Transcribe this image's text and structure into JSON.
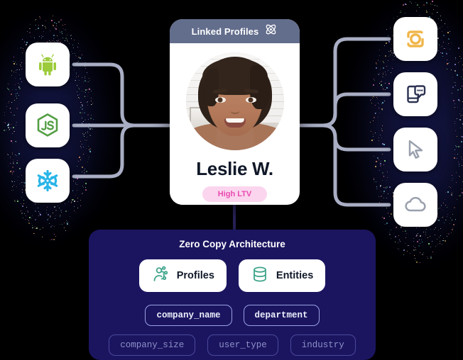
{
  "card": {
    "header_title": "Linked Profiles",
    "header_icon": "atom-icon",
    "person_name": "Leslie W.",
    "badge_label": "High LTV",
    "avatar_alt": "profile-photo"
  },
  "panel": {
    "title": "Zero Copy Architecture",
    "entities": [
      {
        "label": "Profiles",
        "icon": "profile-network-icon"
      },
      {
        "label": "Entities",
        "icon": "database-icon"
      }
    ],
    "fields_primary": [
      "company_name",
      "department"
    ],
    "fields_secondary": [
      "company_size",
      "user_type",
      "industry"
    ]
  },
  "sources": [
    {
      "name": "android",
      "icon": "android-icon",
      "color": "#9ccb3b"
    },
    {
      "name": "nodejs",
      "icon": "nodejs-icon",
      "color": "#539e43"
    },
    {
      "name": "snowflake",
      "icon": "snowflake-icon",
      "color": "#29b5e8"
    }
  ],
  "destinations": [
    {
      "name": "instagram",
      "icon": "instagram-camera-icon",
      "color": "#f0b64b"
    },
    {
      "name": "sms",
      "icon": "phone-message-icon",
      "color": "#2b3150"
    },
    {
      "name": "cursor",
      "icon": "mouse-pointer-icon",
      "color": "#9aa0ad"
    },
    {
      "name": "cloud",
      "icon": "cloud-icon",
      "color": "#9aa0ad"
    }
  ],
  "colors": {
    "background": "#000000",
    "card_header": "#636d8c",
    "panel": "#1b1560",
    "badge_bg": "#fbd5ee",
    "badge_text": "#e84ab0",
    "wire": "#a9aec4",
    "accent_teal": "#3fa58b"
  }
}
